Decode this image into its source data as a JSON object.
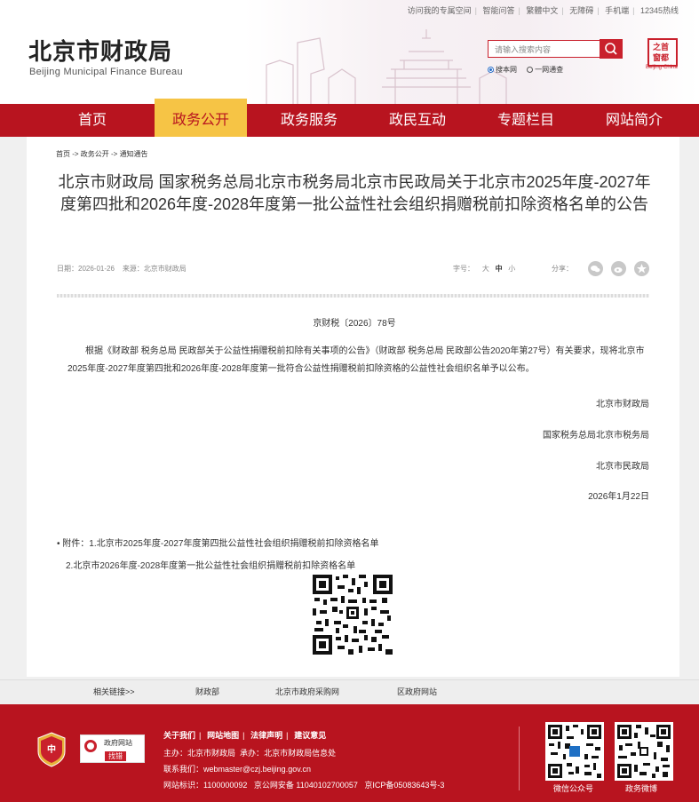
{
  "header": {
    "top_links": [
      "访问我的专属空间",
      "智能问答",
      "繁體中文",
      "无障碍",
      "手机端",
      "12345热线"
    ],
    "logo_cn": "北京市财政局",
    "logo_en": "Beijing Municipal Finance Bureau",
    "search_placeholder": "请输入搜索内容",
    "search_scope_1": "搜本网",
    "search_scope_2": "一网通查",
    "seal_text": "首都之窗",
    "seal_sub": "Beijing·China"
  },
  "nav": {
    "items": [
      "首页",
      "政务公开",
      "政务服务",
      "政民互动",
      "专题栏目",
      "网站简介"
    ],
    "active_index": 1
  },
  "breadcrumb": {
    "parts": [
      "首页",
      "政务公开",
      "通知通告"
    ],
    "separator": " -> "
  },
  "article": {
    "title": "北京市财政局 国家税务总局北京市税务局北京市民政局关于北京市2025年度-2027年度第四批和2026年度-2028年度第一批公益性社会组织捐赠税前扣除资格名单的公告",
    "date_label": "日期：",
    "date": "2026-01-26",
    "source_label": "来源：",
    "source": "北京市财政局",
    "font_size_label": "字号：",
    "font_sizes": [
      "大",
      "中",
      "小"
    ],
    "share_label": "分享：",
    "doc_number": "京财税〔2026〕78号",
    "body": "根据《财政部 税务总局 民政部关于公益性捐赠税前扣除有关事项的公告》（财政部 税务总局 民政部公告2020年第27号）有关要求，现将北京市2025年度-2027年度第四批和2026年度-2028年度第一批符合公益性捐赠税前扣除资格的公益性社会组织名单予以公布。",
    "signatories": [
      "北京市财政局",
      "国家税务总局北京市税务局",
      "北京市民政局"
    ],
    "sign_date": "2026年1月22日",
    "attachments": [
      "• 附件：1.北京市2025年度-2027年度第四批公益性社会组织捐赠税前扣除资格名单",
      "2.北京市2026年度-2028年度第一批公益性社会组织捐赠税前扣除资格名单"
    ]
  },
  "related": {
    "label": "相关链接>>",
    "links": [
      "财政部",
      "北京市政府采购网",
      "区政府网站"
    ]
  },
  "footer": {
    "links": [
      "关于我们",
      "网站地图",
      "法律声明",
      "建议意见"
    ],
    "host_label": "主办：",
    "host": "北京市财政局",
    "operator_label": "承办：",
    "operator": "北京市财政局信息处",
    "contact_label": "联系我们：",
    "contact": "webmaster@czj.beijing.gov.cn",
    "id_label": "网站标识：",
    "site_id": "1100000092",
    "police": "京公网安备 11040102700057",
    "icp": "京ICP备05083643号-3",
    "badge_line1": "政府网站",
    "badge_line2": "找错",
    "emblem_text": "党政机关",
    "qr_labels": [
      "微信公众号",
      "政务微博"
    ]
  },
  "colors": {
    "brand_red": "#b8141f",
    "nav_active": "#f6c445"
  }
}
